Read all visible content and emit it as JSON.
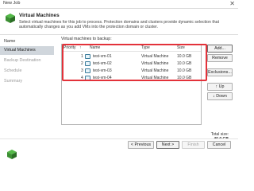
{
  "window": {
    "title": "New Job",
    "close_glyph": "✕"
  },
  "header": {
    "title": "Virtual Machines",
    "description": "Select virtual machines for this job to process. Protection domains and clusters provide dynamic selection that automatically changes as you add VMs into the protection domain or cluster.",
    "icon": "veeam-cube-icon"
  },
  "sidebar": {
    "items": [
      {
        "label": "Name",
        "state": "normal"
      },
      {
        "label": "Virtual Machines",
        "state": "active"
      },
      {
        "label": "Backup Destination",
        "state": "disabled"
      },
      {
        "label": "Schedule",
        "state": "disabled"
      },
      {
        "label": "Summary",
        "state": "disabled"
      }
    ]
  },
  "main": {
    "list_label": "Virtual machines to backup:",
    "columns": {
      "priority": "Priority",
      "sort": "↑",
      "name": "Name",
      "type": "Type",
      "size": "Size"
    },
    "rows": [
      {
        "priority": "1",
        "name": "test-vm-01",
        "type": "Virtual Machine",
        "size": "10.0 GB"
      },
      {
        "priority": "2",
        "name": "test-vm-02",
        "type": "Virtual Machine",
        "size": "10.0 GB"
      },
      {
        "priority": "3",
        "name": "test-vm-03",
        "type": "Virtual Machine",
        "size": "10.0 GB"
      },
      {
        "priority": "4",
        "name": "test-vm-04",
        "type": "Virtual Machine",
        "size": "10.0 GB"
      }
    ],
    "side_buttons": {
      "add": "Add...",
      "remove": "Remove",
      "exclusions": "Exclusions...",
      "up": "↑  Up",
      "down": "↓  Down"
    },
    "total_label": "Total size:",
    "total_value": "40.0 GB"
  },
  "footer": {
    "previous": "< Previous",
    "next": "Next >",
    "finish": "Finish",
    "cancel": "Cancel"
  },
  "colors": {
    "highlight": "#e3323a",
    "active_nav": "#d0d6dc",
    "brand_green": "#3aa935"
  }
}
